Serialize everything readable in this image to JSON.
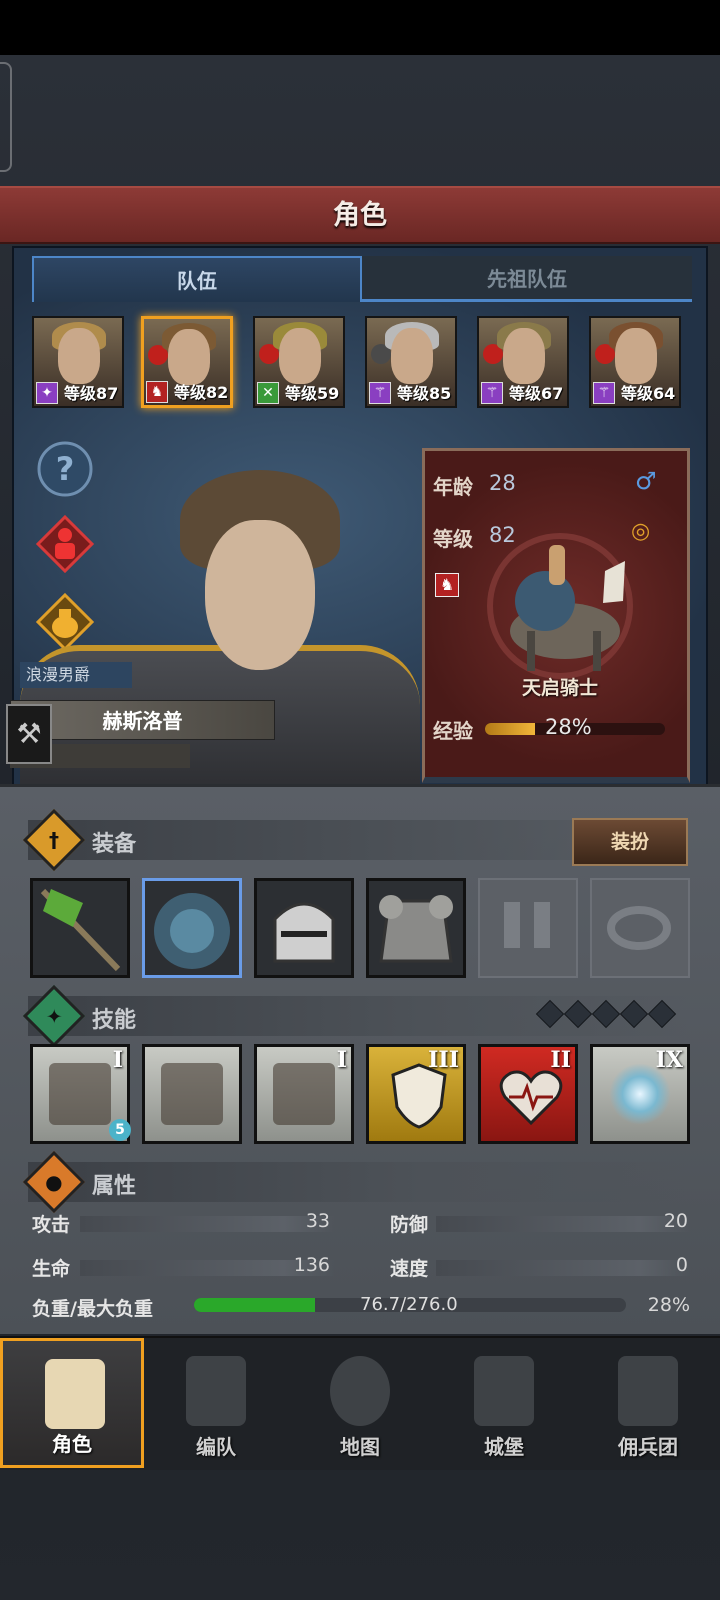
{
  "header": {
    "title": "角色"
  },
  "tabs": [
    {
      "label": "队伍",
      "active": true
    },
    {
      "label": "先祖队伍",
      "active": false
    }
  ],
  "party": [
    {
      "level": "等级87",
      "class_color": "#8a3fc1",
      "selected": false
    },
    {
      "level": "等级82",
      "class_color": "#b32222",
      "selected": true
    },
    {
      "level": "等级59",
      "class_color": "#3a9a3a",
      "selected": false
    },
    {
      "level": "等级85",
      "class_color": "#8a3fc1",
      "selected": false
    },
    {
      "level": "等级67",
      "class_color": "#8a3fc1",
      "selected": false
    },
    {
      "level": "等级64",
      "class_color": "#8a3fc1",
      "selected": false
    }
  ],
  "character": {
    "trait": "浪漫男爵",
    "name": "赫斯洛普",
    "age_label": "年龄",
    "age": "28",
    "level_label": "等级",
    "level": "82",
    "class_name": "天启骑士",
    "exp_label": "经验",
    "exp_percent": "28%",
    "exp_fraction": 0.28,
    "gender_icon": "male-icon",
    "status_icon": "rings-icon"
  },
  "equipment": {
    "title": "装备",
    "dress_button": "装扮"
  },
  "skills": {
    "title": "技能",
    "ranks": [
      "I",
      "",
      "I",
      "III",
      "II",
      "IX"
    ],
    "badge": "5"
  },
  "attributes": {
    "title": "属性",
    "attack_label": "攻击",
    "attack": "33",
    "defense_label": "防御",
    "defense": "20",
    "hp_label": "生命",
    "hp": "136",
    "speed_label": "速度",
    "speed": "0",
    "load_label": "负重/最大负重",
    "load_value": "76.7/276.0",
    "load_percent": "28%",
    "load_fraction": 0.28
  },
  "nav": [
    {
      "label": "角色",
      "active": true
    },
    {
      "label": "编队",
      "active": false
    },
    {
      "label": "地图",
      "active": false
    },
    {
      "label": "城堡",
      "active": false
    },
    {
      "label": "佣兵团",
      "active": false
    }
  ],
  "colors": {
    "accent": "#f0a020",
    "tab_border": "#4d86c8",
    "title_bar": "#7a2e2a",
    "load_green": "#2aa82a"
  }
}
